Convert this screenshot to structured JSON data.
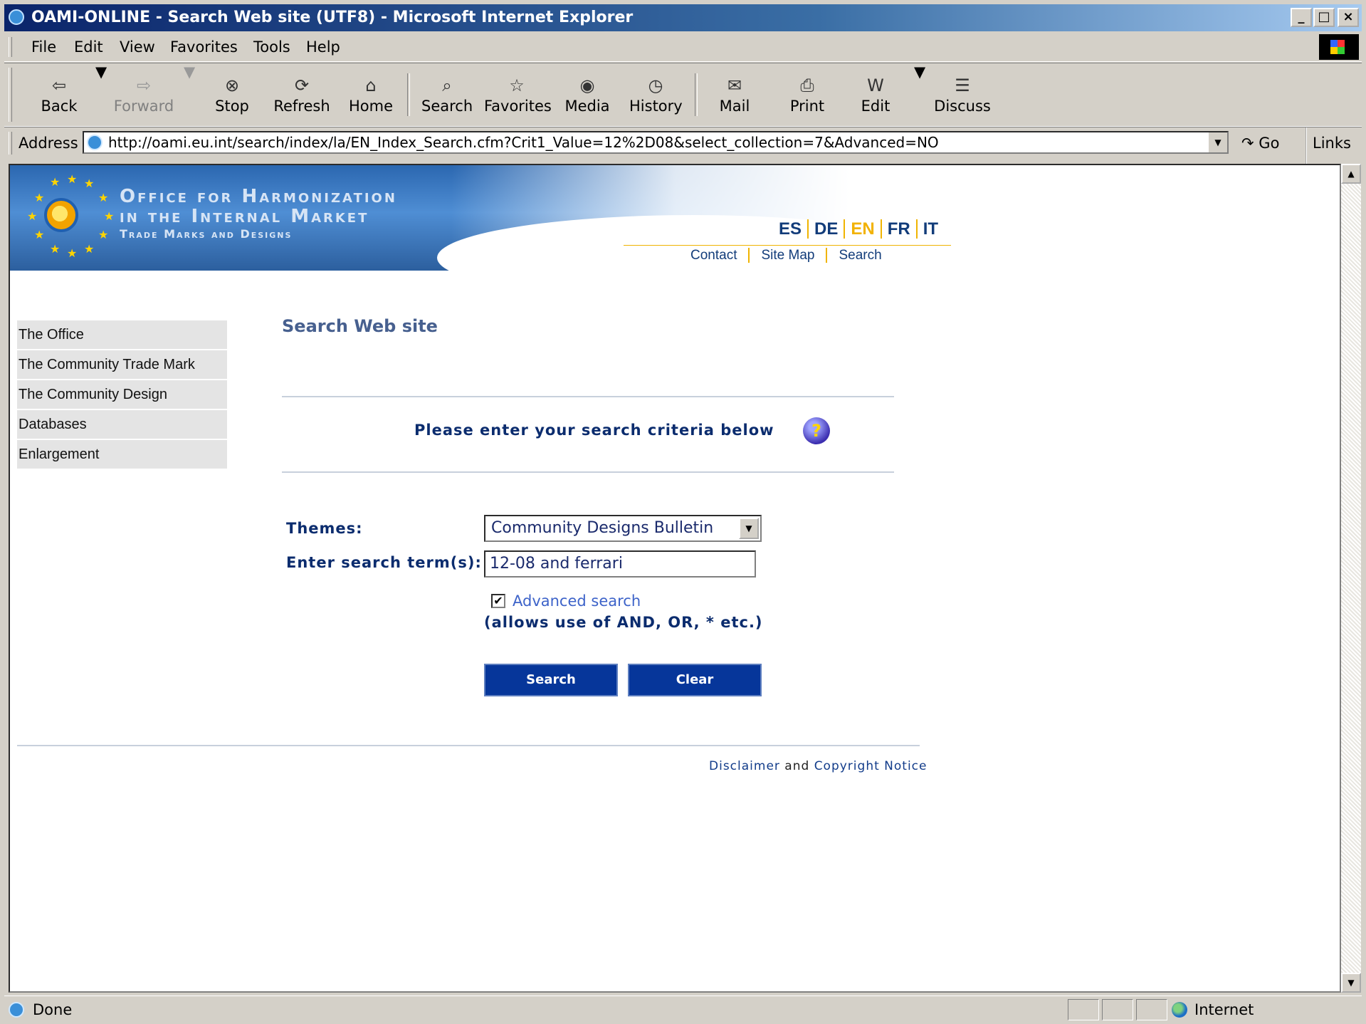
{
  "window": {
    "title": "OAMI-ONLINE - Search Web site (UTF8) - Microsoft Internet Explorer"
  },
  "menus": [
    "File",
    "Edit",
    "View",
    "Favorites",
    "Tools",
    "Help"
  ],
  "toolbar": {
    "back": "Back",
    "forward": "Forward",
    "stop": "Stop",
    "refresh": "Refresh",
    "home": "Home",
    "search": "Search",
    "favorites": "Favorites",
    "media": "Media",
    "history": "History",
    "mail": "Mail",
    "print": "Print",
    "edit": "Edit",
    "discuss": "Discuss"
  },
  "address": {
    "label": "Address",
    "url": "http://oami.eu.int/search/index/la/EN_Index_Search.cfm?Crit1_Value=12%2D08&select_collection=7&Advanced=NO",
    "go": "Go",
    "links": "Links"
  },
  "banner": {
    "line1": "Office for Harmonization",
    "line2": "in the Internal Market",
    "line3": "Trade Marks and Designs",
    "languages": [
      "ES",
      "DE",
      "EN",
      "FR",
      "IT"
    ],
    "active_language": "EN",
    "links": [
      "Contact",
      "Site Map",
      "Search"
    ]
  },
  "nav": [
    "The Office",
    "The Community Trade Mark",
    "The Community Design",
    "Databases",
    "Enlargement"
  ],
  "page": {
    "title": "Search Web site",
    "criteria": "Please enter your search criteria below",
    "themes_label": "Themes:",
    "themes_value": "Community Designs Bulletin",
    "term_label": "Enter search term(s):",
    "term_value": "12-08 and ferrari",
    "advanced_label": "Advanced search",
    "advanced_checked": true,
    "allows": "(allows use of AND, OR, * etc.)",
    "search_btn": "Search",
    "clear_btn": "Clear"
  },
  "footer": {
    "disclaimer": "Disclaimer",
    "and": "and",
    "copyright": "Copyright Notice"
  },
  "status": {
    "text": "Done",
    "zone": "Internet"
  }
}
